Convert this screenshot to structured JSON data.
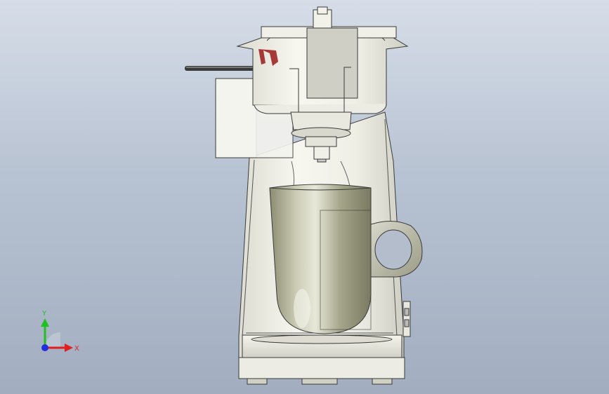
{
  "triad": {
    "x_label": "X",
    "y_label": "Y",
    "x_color": "#e02020",
    "y_color": "#20c020",
    "z_color": "#2030e0"
  },
  "colors": {
    "background_top": "#d6dde8",
    "background_bottom": "#a2aec0",
    "edge": "#3a3a3a",
    "body": "#f2f2ea",
    "mug": "#a9a98f",
    "handle": "#bcbcae",
    "accent_red": "#9a1a1a"
  },
  "model": {
    "parts": [
      "coffee-maker-body",
      "hopper",
      "lid-panel",
      "filter-basket",
      "drip-nozzle",
      "mug",
      "mug-handle",
      "drip-tray",
      "base",
      "side-handle-rod",
      "side-panel"
    ]
  }
}
